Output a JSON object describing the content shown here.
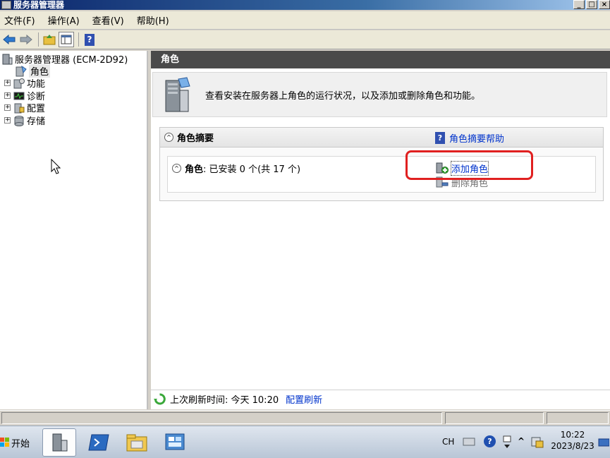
{
  "window": {
    "title": "服务器管理器",
    "buttons": [
      "_",
      "□",
      "×"
    ]
  },
  "menu": [
    "文件(F)",
    "操作(A)",
    "查看(V)",
    "帮助(H)"
  ],
  "toolbar": {
    "icons": [
      "back-arrow-icon",
      "forward-arrow-icon",
      "up-folder-icon",
      "console-tree-icon",
      "help-icon"
    ],
    "help_glyph": "?"
  },
  "tree": {
    "root": "服务器管理器 (ECM-2D92)",
    "items": [
      {
        "label": "角色",
        "selected": true
      },
      {
        "label": "功能",
        "expander": "+"
      },
      {
        "label": "诊断",
        "expander": "+"
      },
      {
        "label": "配置",
        "expander": "+"
      },
      {
        "label": "存储",
        "expander": "+"
      }
    ]
  },
  "pane": {
    "header": "角色",
    "intro": "查看安装在服务器上角色的运行状况，以及添加或删除角色和功能。",
    "summary": {
      "title": "角色摘要",
      "help_link": "角色摘要帮助",
      "help_glyph": "?",
      "collapse_glyph": "^",
      "roles_label": "角色",
      "roles_status": ": 已安装 0 个(共 17 个)",
      "actions": [
        {
          "label": "添加角色",
          "enabled": true
        },
        {
          "label": "删除角色",
          "enabled": false
        }
      ]
    },
    "refresh": {
      "text": "上次刷新时间: 今天 10:20",
      "link": "配置刷新"
    }
  },
  "taskbar": {
    "start": "开始",
    "lang": "CH",
    "time": "10:22",
    "date": "2023/8/23",
    "tray_glyphs": [
      "?",
      "^"
    ]
  },
  "colors": {
    "title_blue": "#0a246a",
    "link_blue": "#0033cc",
    "highlight_red": "#e02020",
    "pane_header": "#4a4a4a"
  }
}
